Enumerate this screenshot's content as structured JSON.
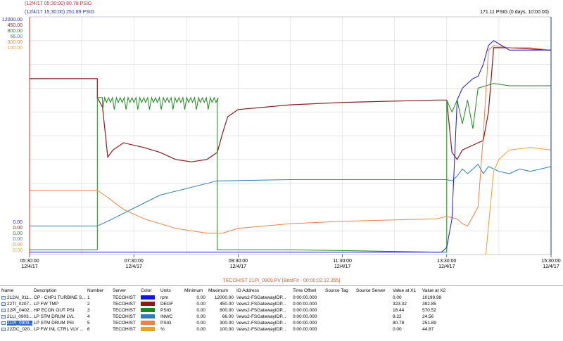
{
  "cursors": {
    "x1_readout": "(12/4/17 05:30:00) 80.78 PSIG",
    "x2_readout": "(12/4/17 15:30:00) 251.89 PSIG",
    "x1_color": "#d0282e",
    "x2_color": "#2030b0"
  },
  "range_readout": "171.11 PSIG (0 days, 10:00:00)",
  "chart": {
    "y_axes": [
      {
        "color": "#2222dd",
        "ticks": [
          "12000.00",
          "0.00"
        ]
      },
      {
        "color": "#8b1a1a",
        "ticks": [
          "450.00",
          "0.00"
        ]
      },
      {
        "color": "#1a8a1a",
        "ticks": [
          "800.00",
          "0.00"
        ]
      },
      {
        "color": "#2a7fb8",
        "ticks": [
          "66.00",
          "0.00"
        ]
      },
      {
        "color": "#f08040",
        "ticks": [
          "300.00",
          "0.00"
        ]
      },
      {
        "color": "#f0a020",
        "ticks": [
          "100.00",
          "0.00"
        ]
      }
    ],
    "x_ticks": [
      {
        "time": "05:30:00",
        "date": "12/4/17"
      },
      {
        "time": "07:30:00",
        "date": "12/4/17"
      },
      {
        "time": "09:30:00",
        "date": "12/4/17"
      },
      {
        "time": "11:30:00",
        "date": "12/4/17"
      },
      {
        "time": "13:30:00",
        "date": "12/4/17"
      },
      {
        "time": "15:30:00",
        "date": "12/4/17"
      }
    ]
  },
  "tag_title": "TECOHIST 21PI_0909.PV [BestFit - 00:00:02.12.355]",
  "table": {
    "headers": [
      "Name",
      "Description",
      "Number",
      "Server",
      "Color",
      "Units",
      "Minimum",
      "Maximum",
      "IO Address",
      "Time Offset",
      "Source Tag",
      "Source Server",
      "Value at X1",
      "Value at X2"
    ],
    "rows": [
      {
        "name": "212AI_011...",
        "desc": "CP - CHP1 TURBINE S...",
        "num": "1",
        "server": "TECOHIST",
        "color": "#1414e6",
        "units": "rpm",
        "min": "0.00",
        "max": "12000.00",
        "io": "\\\\ews2-FSGatewayIDP...",
        "offset": "0:00:00.000",
        "x1": "0.00",
        "x2": "10199.99",
        "selected": false
      },
      {
        "name": "22TI_0207...",
        "desc": "LP FW TMP",
        "num": "2",
        "server": "TECOHIST",
        "color": "#8b1a1a",
        "units": "DEGF",
        "min": "0.00",
        "max": "450.00",
        "io": "\\\\ews2-FSGatewayIDP...",
        "offset": "0:00:00.000",
        "x1": "323.32",
        "x2": "392.85",
        "selected": false
      },
      {
        "name": "22PI_0402...",
        "desc": "HP ECON OUT PSI",
        "num": "3",
        "server": "TECOHIST",
        "color": "#1a8a1a",
        "units": "PSIG",
        "min": "0.00",
        "max": "800.00",
        "io": "\\\\ews2-FSGatewayIDP...",
        "offset": "0:00:00.000",
        "x1": "16.44",
        "x2": "570.52",
        "selected": false
      },
      {
        "name": "21LI_0903...",
        "desc": "LP STM DRUM LVL",
        "num": "4",
        "server": "TECOHIST",
        "color": "#2a7fb8",
        "units": "INWC",
        "min": "0.00",
        "max": "66.00",
        "io": "\\\\ews2-FSGatewayIDP...",
        "offset": "0:00:00.000",
        "x1": "8.22",
        "x2": "24.56",
        "selected": false
      },
      {
        "name": "21PI_0909...",
        "desc": "LP STM DRUM PSI",
        "num": "5",
        "server": "TECOHIST",
        "color": "#f08040",
        "units": "PSIG",
        "min": "0.00",
        "max": "300.00",
        "io": "\\\\ews2-FSGatewayIDP...",
        "offset": "0:00:00.000",
        "x1": "80.78",
        "x2": "251.89",
        "selected": true
      },
      {
        "name": "22ZIC_020...",
        "desc": "LP FW INL CTRL VLV ...",
        "num": "6",
        "server": "TECOHIST",
        "color": "#f0a020",
        "units": "%",
        "min": "0.00",
        "max": "100.00",
        "io": "\\\\ews2-FSGatewayIDP...",
        "offset": "0:00:00.000",
        "x1": "0.00",
        "x2": "44.87",
        "selected": false
      }
    ]
  }
}
